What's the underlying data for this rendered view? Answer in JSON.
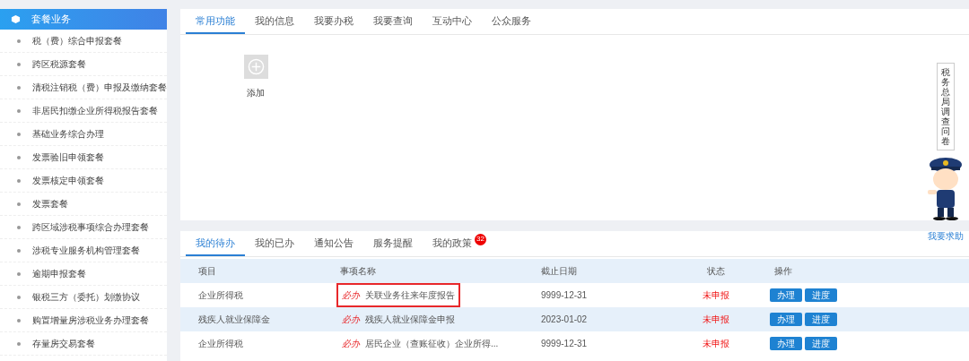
{
  "sidebar": {
    "title": "套餐业务",
    "items": [
      {
        "label": "税（费）综合申报套餐"
      },
      {
        "label": "跨区税源套餐"
      },
      {
        "label": "清税注销税（费）申报及缴纳套餐"
      },
      {
        "label": "非居民扣缴企业所得税报告套餐"
      },
      {
        "label": "基础业务综合办理"
      },
      {
        "label": "发票验旧申领套餐"
      },
      {
        "label": "发票核定申领套餐"
      },
      {
        "label": "发票套餐"
      },
      {
        "label": "跨区域涉税事项综合办理套餐"
      },
      {
        "label": "涉税专业服务机构管理套餐"
      },
      {
        "label": "逾期申报套餐"
      },
      {
        "label": "银税三方（委托）划缴协议"
      },
      {
        "label": "购置增量房涉税业务办理套餐"
      },
      {
        "label": "存量房交易套餐"
      }
    ]
  },
  "top_panel": {
    "tabs": [
      {
        "label": "常用功能",
        "selected": true
      },
      {
        "label": "我的信息",
        "selected": false
      },
      {
        "label": "我要办税",
        "selected": false
      },
      {
        "label": "我要查询",
        "selected": false
      },
      {
        "label": "互动中心",
        "selected": false
      },
      {
        "label": "公众服务",
        "selected": false
      }
    ],
    "add_tile": {
      "label": "添加"
    }
  },
  "bottom_panel": {
    "tabs": [
      {
        "label": "我的待办",
        "selected": true
      },
      {
        "label": "我的已办",
        "selected": false
      },
      {
        "label": "通知公告",
        "selected": false
      },
      {
        "label": "服务提醒",
        "selected": false
      },
      {
        "label": "我的政策",
        "selected": false,
        "badge": "32"
      }
    ],
    "table": {
      "columns": [
        "项目",
        "事项名称",
        "截止日期",
        "状态",
        "操作"
      ],
      "rows": [
        {
          "item": "企业所得税",
          "tag": "必办",
          "name": "关联业务往来年度报告",
          "deadline": "9999-12-31",
          "status": "未申报",
          "actions": [
            "办理",
            "进度"
          ],
          "highlighted": true
        },
        {
          "item": "残疾人就业保障金",
          "tag": "必办",
          "name": "残疾人就业保障金申报",
          "deadline": "2023-01-02",
          "status": "未申报",
          "actions": [
            "办理",
            "进度"
          ],
          "highlighted": false
        },
        {
          "item": "企业所得税",
          "tag": "必办",
          "name": "居民企业（查账征收）企业所得...",
          "deadline": "9999-12-31",
          "status": "未申报",
          "actions": [
            "办理",
            "进度"
          ],
          "highlighted": false
        }
      ]
    }
  },
  "floating": {
    "survey": "税务总局调查问卷",
    "help": "我要求助"
  }
}
